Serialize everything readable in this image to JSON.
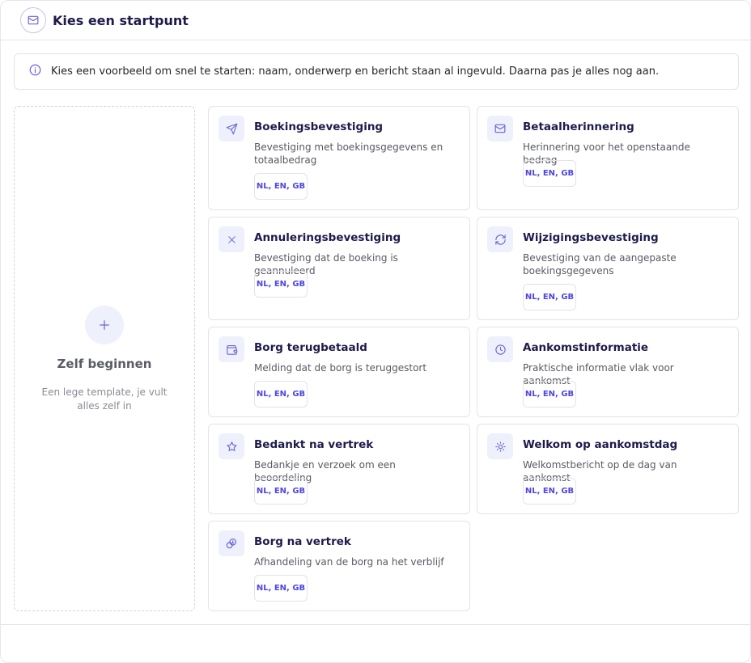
{
  "header": {
    "title": "Kies een startpunt",
    "icon": "mail-icon"
  },
  "info": {
    "text": "Kies een voorbeeld om snel te starten: naam, onderwerp en bericht staan al ingevuld. Daarna pas je alles nog aan.",
    "icon": "info-icon"
  },
  "blank": {
    "title": "Zelf beginnen",
    "description": "Een lege template, je vult alles zelf in",
    "icon": "plus-icon"
  },
  "templates": [
    {
      "title": "Boekingsbevestiging",
      "description": "Bevestiging met boekingsgegevens en totaalbedrag",
      "tag": "NL, EN, GB",
      "icon": "send-icon"
    },
    {
      "title": "Betaalherinnering",
      "description": "Herinnering voor het openstaande bedrag",
      "tag": "NL, EN, GB",
      "icon": "mail-icon"
    },
    {
      "title": "Annuleringsbevestiging",
      "description": "Bevestiging dat de boeking is geannuleerd",
      "tag": "NL, EN, GB",
      "icon": "close-icon"
    },
    {
      "title": "Wijzigingsbevestiging",
      "description": "Bevestiging van de aangepaste boekingsgegevens",
      "tag": "NL, EN, GB",
      "icon": "refresh-icon"
    },
    {
      "title": "Borg terugbetaald",
      "description": "Melding dat de borg is teruggestort",
      "tag": "NL, EN, GB",
      "icon": "wallet-icon"
    },
    {
      "title": "Aankomstinformatie",
      "description": "Praktische informatie vlak voor aankomst",
      "tag": "NL, EN, GB",
      "icon": "clock-icon"
    },
    {
      "title": "Bedankt na vertrek",
      "description": "Bedankje en verzoek om een beoordeling",
      "tag": "NL, EN, GB",
      "icon": "star-icon"
    },
    {
      "title": "Welkom op aankomstdag",
      "description": "Welkomstbericht op de dag van aankomst",
      "tag": "NL, EN, GB",
      "icon": "sun-icon"
    },
    {
      "title": "Borg na vertrek",
      "description": "Afhandeling van de borg na het verblijf",
      "tag": "NL, EN, GB",
      "icon": "coins-icon"
    }
  ],
  "colors": {
    "accent": "#4f46e5",
    "icon_bg": "#eef0fb",
    "title": "#1e1b4b"
  }
}
